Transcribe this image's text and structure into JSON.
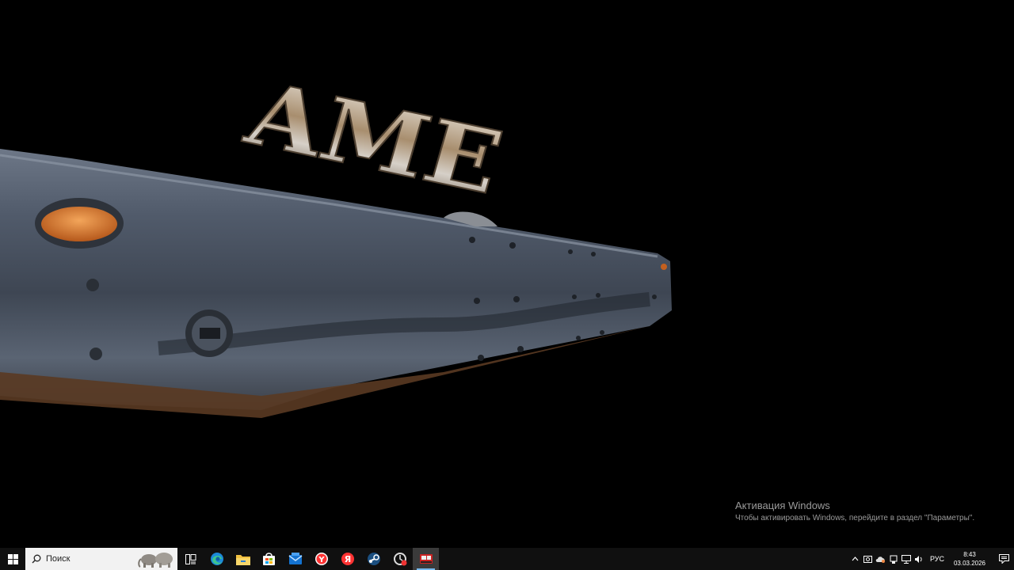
{
  "window": {
    "scene_title_text": "AME"
  },
  "watermark": {
    "title": "Активация Windows",
    "subtitle": "Чтобы активировать Windows, перейдите в раздел \"Параметры\"."
  },
  "taskbar": {
    "search_placeholder": "Поиск",
    "apps": [
      {
        "name": "task-view",
        "icon": "task-view-icon"
      },
      {
        "name": "edge",
        "icon": "edge-icon"
      },
      {
        "name": "file-explorer",
        "icon": "folder-icon"
      },
      {
        "name": "store",
        "icon": "store-icon"
      },
      {
        "name": "mail",
        "icon": "mail-icon"
      },
      {
        "name": "yandex-browser",
        "icon": "yandex-browser-icon"
      },
      {
        "name": "yandex",
        "icon": "yandex-icon"
      },
      {
        "name": "steam",
        "icon": "steam-icon"
      },
      {
        "name": "app-updater",
        "icon": "updater-icon"
      },
      {
        "name": "ats-game",
        "icon": "truck-icon",
        "active": true
      }
    ],
    "tray": {
      "language": "РУС",
      "time": "8:43",
      "date": "03.03.2026"
    }
  },
  "colors": {
    "taskbar": "#101010",
    "accent": "#76b9ed",
    "watermark": "#9a9a9a"
  }
}
